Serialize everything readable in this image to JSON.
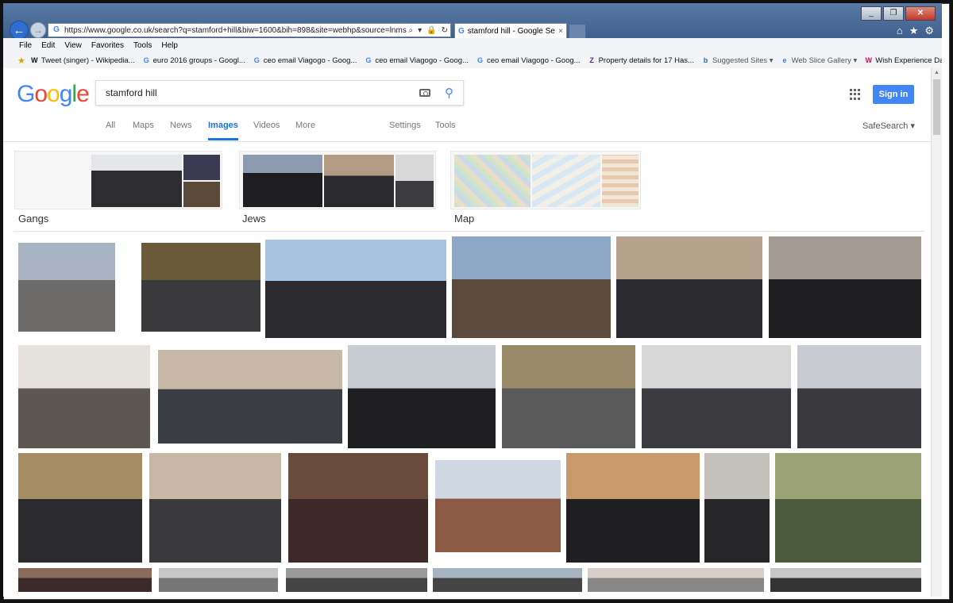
{
  "browser": {
    "url": "https://www.google.co.uk/search?q=stamford+hill&biw=1600&bih=898&site=webhp&source=lnms&tbm=isch&sa=X",
    "tab_title": "stamford hill - Google Search",
    "tab_close": "×",
    "controls": {
      "search": "⌕",
      "dropdown": "▾",
      "lock": "🔒",
      "refresh": "↻"
    },
    "window_buttons": {
      "minimize": "_",
      "restore": "❐",
      "close": "✕"
    },
    "right_icons": {
      "home": "⌂",
      "favorites": "★",
      "tools": "⚙"
    }
  },
  "menubar": [
    "File",
    "Edit",
    "View",
    "Favorites",
    "Tools",
    "Help"
  ],
  "favorites": [
    {
      "label": "Tweet (singer) - Wikipedia...",
      "icon": "W",
      "color": "#111"
    },
    {
      "label": "euro 2016 groups - Googl...",
      "icon": "G",
      "color": "#4285f4"
    },
    {
      "label": "ceo email Viagogo - Goog...",
      "icon": "G",
      "color": "#4285f4"
    },
    {
      "label": "ceo email Viagogo - Goog...",
      "icon": "G",
      "color": "#4285f4"
    },
    {
      "label": "ceo email Viagogo - Goog...",
      "icon": "G",
      "color": "#4285f4"
    },
    {
      "label": "Property details for 17 Has...",
      "icon": "Z",
      "color": "#5b2a86"
    },
    {
      "label": "Suggested Sites ▾",
      "icon": "b",
      "color": "#1b6fb8",
      "grey": true
    },
    {
      "label": "Web Slice Gallery ▾",
      "icon": "e",
      "color": "#3b7ad6",
      "grey": true
    },
    {
      "label": "Wish Experience Days & G...",
      "icon": "W",
      "color": "#c2185b"
    }
  ],
  "google": {
    "logo": [
      "G",
      "o",
      "o",
      "g",
      "l",
      "e"
    ],
    "query": "stamford hill",
    "sign_in": "Sign in",
    "tabs": [
      "All",
      "Maps",
      "News",
      "Images",
      "Videos",
      "More",
      "Settings",
      "Tools"
    ],
    "active_tab": "Images",
    "safesearch": "SafeSearch ▾"
  },
  "related": [
    {
      "label": "Gangs"
    },
    {
      "label": "Jews"
    },
    {
      "label": "Map"
    }
  ],
  "results_count_rows": 4,
  "colors": {
    "accent": "#4285f4",
    "link_active": "#1a73e8"
  }
}
